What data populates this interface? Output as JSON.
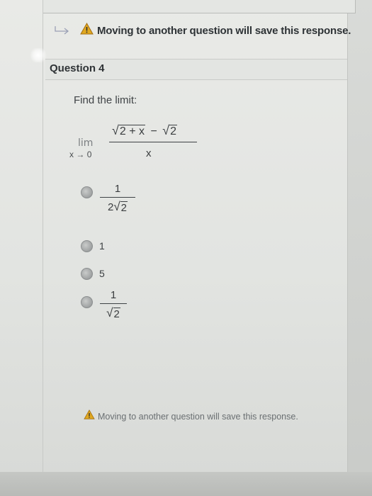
{
  "notice": {
    "text": "Moving to another question will save this response.",
    "icon": "warning-triangle-icon",
    "arrow_icon": "arrow-right-icon"
  },
  "question": {
    "title": "Question 4",
    "prompt": "Find the limit:",
    "limit": {
      "operator": "lim",
      "approach_var": "x",
      "approach_arrow": "→",
      "approach_value": "0",
      "num_radicand_1": "2 + x",
      "num_minus": "−",
      "num_radicand_2": "2",
      "denominator": "x"
    }
  },
  "options": [
    {
      "type": "fraction",
      "numerator": "1",
      "den_coef": "2",
      "den_radicand": "2"
    },
    {
      "type": "value",
      "text": "1"
    },
    {
      "type": "value",
      "text": "5"
    },
    {
      "type": "fraction",
      "numerator": "1",
      "den_coef": "",
      "den_radicand": "2"
    }
  ],
  "colors": {
    "warning": "#e0a81f",
    "text": "#3a3d3f",
    "radio": "#9a9d9e"
  }
}
